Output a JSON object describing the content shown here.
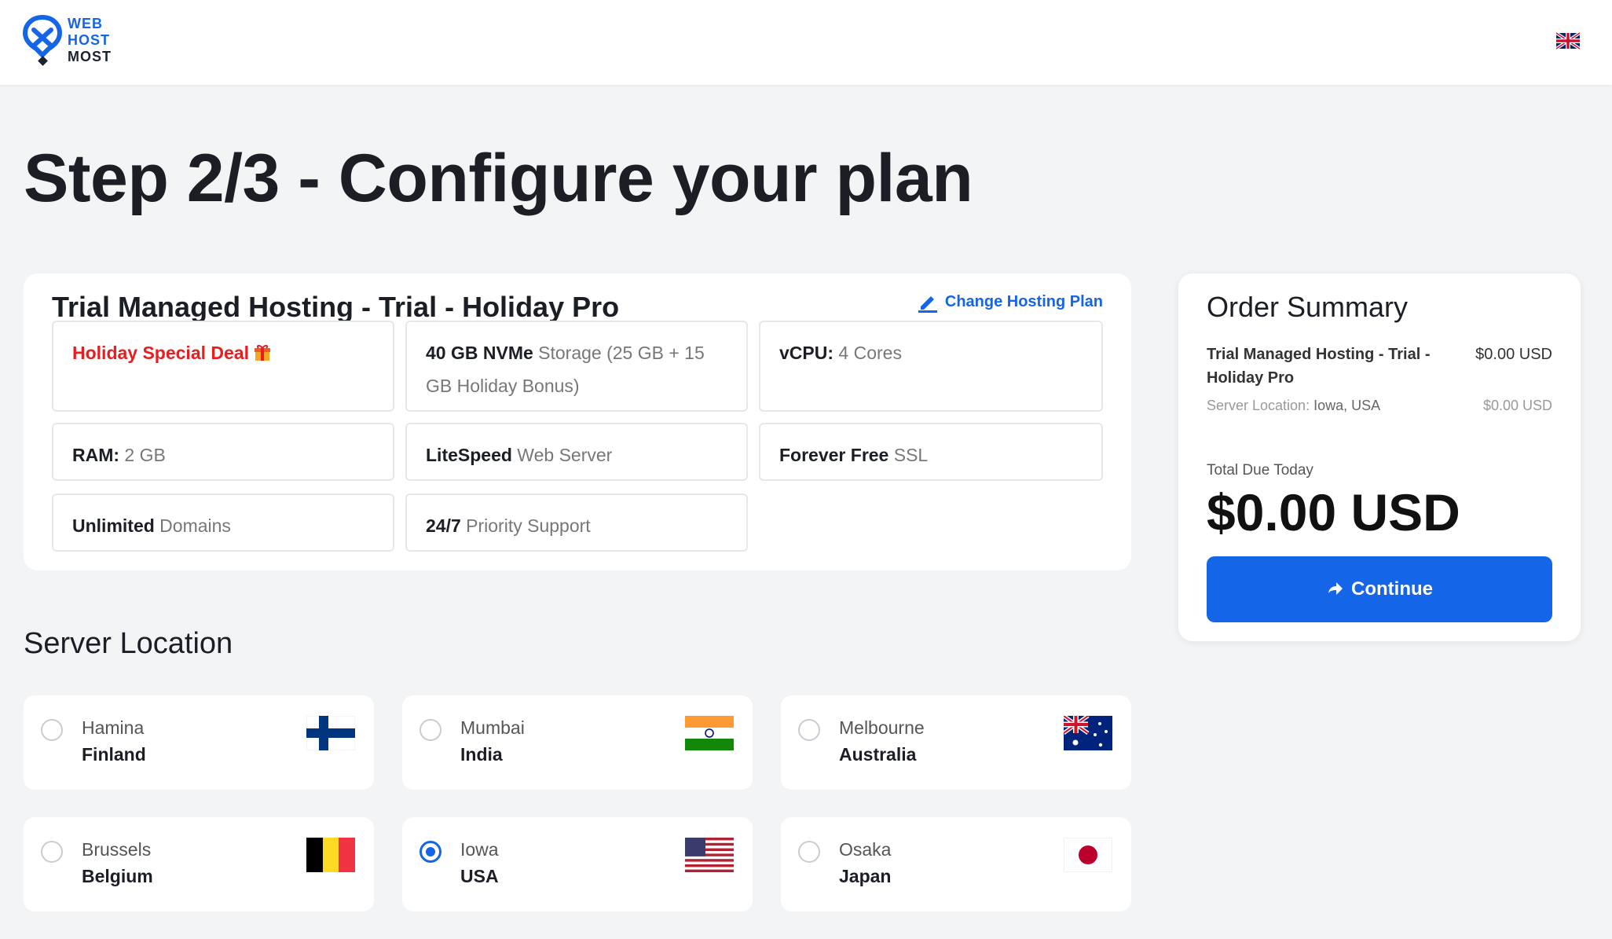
{
  "header": {
    "logo_line1": "WEB",
    "logo_line2": "HOST",
    "logo_line3": "MOST",
    "language_icon": "uk-flag-icon"
  },
  "page_title": "Step 2/3 - Configure your plan",
  "plan": {
    "title": "Trial Managed Hosting - Trial - Holiday Pro",
    "change_label": "Change Hosting Plan",
    "features": {
      "deal": "Holiday Special Deal",
      "storage_bold": "40 GB NVMe",
      "storage_rest": " Storage (25 GB + 15 GB Holiday Bonus)",
      "vcpu_bold": "vCPU:",
      "vcpu_rest": " 4 Cores",
      "ram_bold": "RAM:",
      "ram_rest": " 2 GB",
      "server_bold": "LiteSpeed",
      "server_rest": " Web Server",
      "ssl_bold": "Forever Free",
      "ssl_rest": " SSL",
      "domains_bold": "Unlimited",
      "domains_rest": " Domains",
      "support_bold": "24/7",
      "support_rest": " Priority Support"
    }
  },
  "server_location": {
    "title": "Server Location",
    "locations": [
      {
        "city": "Hamina",
        "country": "Finland",
        "flag": "finland-flag-icon",
        "selected": false
      },
      {
        "city": "Mumbai",
        "country": "India",
        "flag": "india-flag-icon",
        "selected": false
      },
      {
        "city": "Melbourne",
        "country": "Australia",
        "flag": "australia-flag-icon",
        "selected": false
      },
      {
        "city": "Brussels",
        "country": "Belgium",
        "flag": "belgium-flag-icon",
        "selected": false
      },
      {
        "city": "Iowa",
        "country": "USA",
        "flag": "usa-flag-icon",
        "selected": true
      },
      {
        "city": "Osaka",
        "country": "Japan",
        "flag": "japan-flag-icon",
        "selected": false
      }
    ]
  },
  "summary": {
    "title": "Order Summary",
    "product": "Trial Managed Hosting - Trial - Holiday Pro",
    "product_price": "$0.00 USD",
    "location_label": "Server Location:",
    "location_value": "Iowa, USA",
    "location_price": "$0.00 USD",
    "total_label": "Total Due Today",
    "total_value": "$0.00 USD",
    "continue_label": "Continue"
  },
  "colors": {
    "accent": "#1565e8",
    "deal_red": "#e81d1d",
    "background": "#f3f4f6"
  }
}
